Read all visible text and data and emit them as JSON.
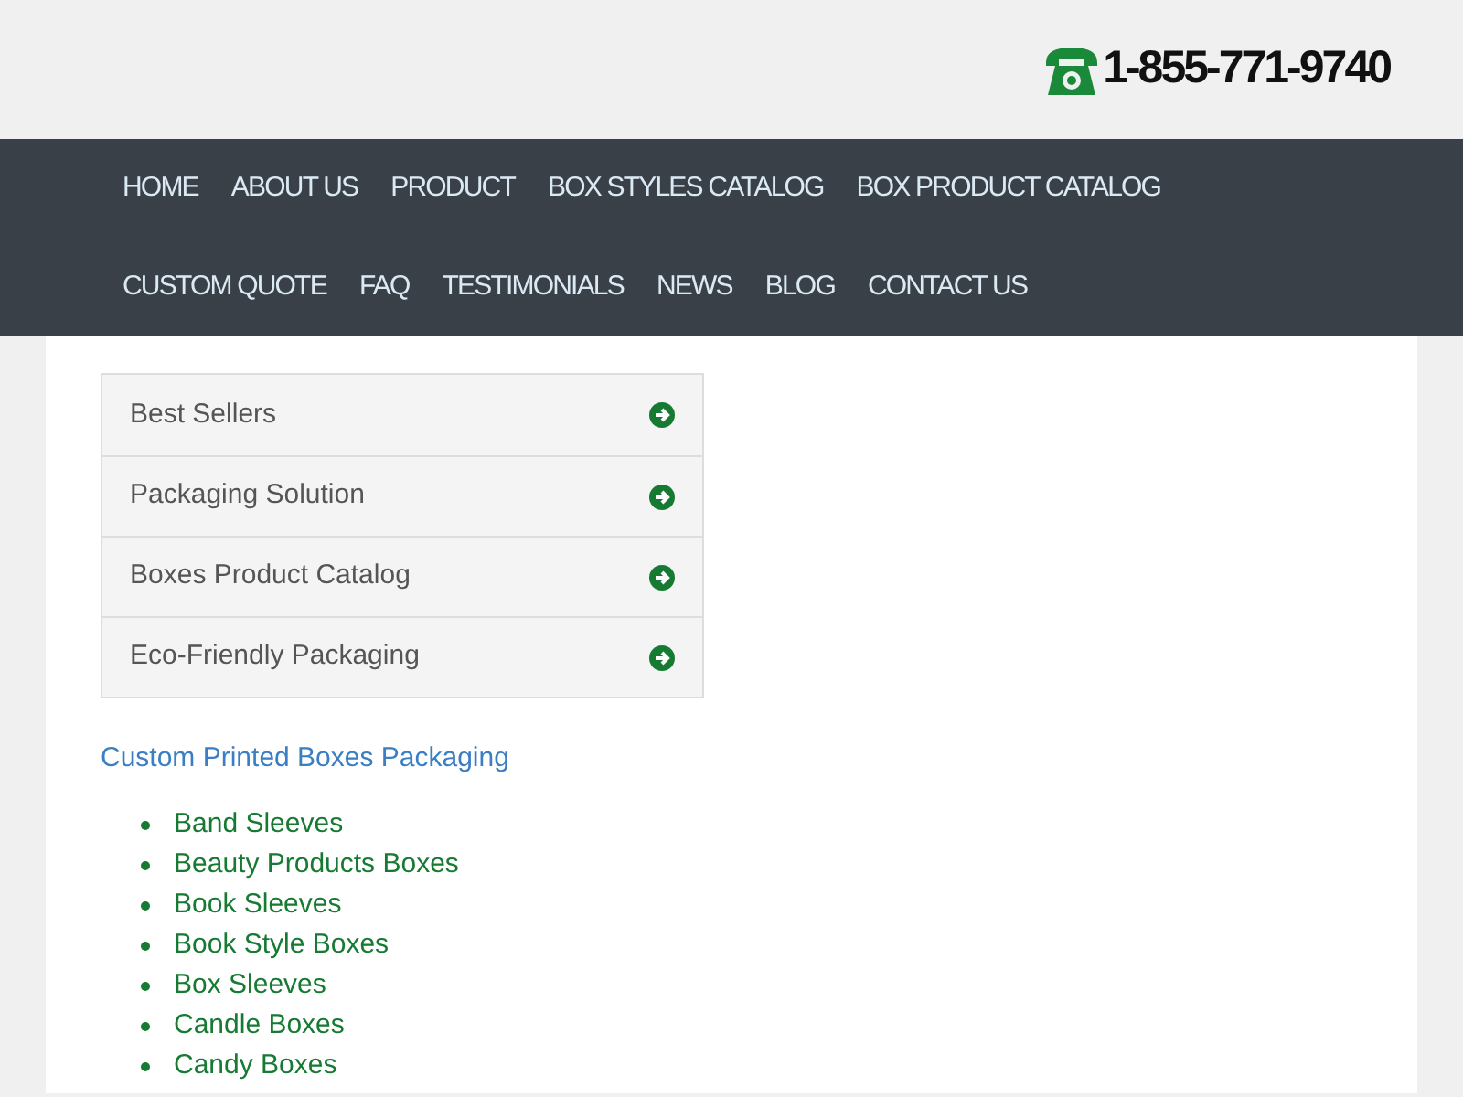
{
  "header": {
    "phone": "1-855-771-9740"
  },
  "nav": [
    "HOME",
    "ABOUT US",
    "PRODUCT",
    "BOX STYLES CATALOG",
    "BOX PRODUCT CATALOG",
    "CUSTOM QUOTE",
    "FAQ",
    "TESTIMONIALS",
    "NEWS",
    "BLOG",
    "CONTACT US"
  ],
  "menu": [
    "Best Sellers",
    "Packaging Solution",
    "Boxes Product Catalog",
    "Eco-Friendly Packaging"
  ],
  "section_link": "Custom Printed Boxes Packaging",
  "products": [
    "Band Sleeves",
    "Beauty Products Boxes",
    "Book Sleeves",
    "Book Style Boxes",
    "Box Sleeves",
    "Candle Boxes",
    "Candy Boxes"
  ]
}
